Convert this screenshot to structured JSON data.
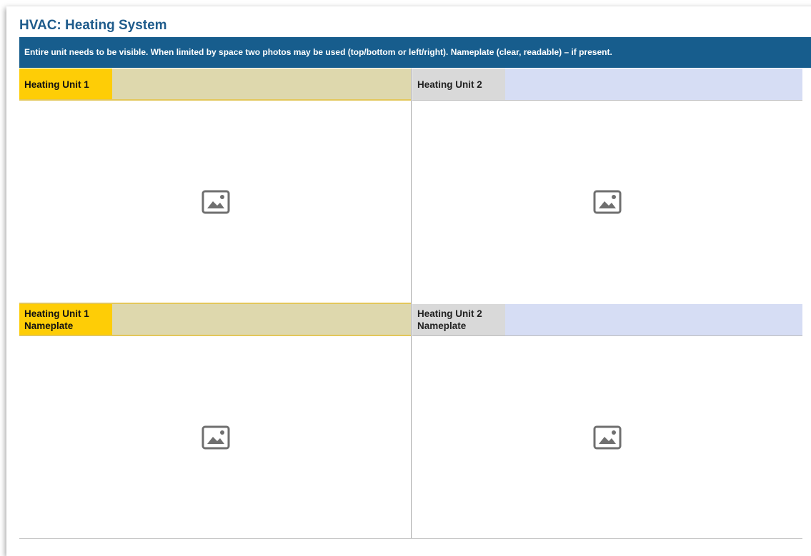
{
  "page": {
    "title": "HVAC: Heating System",
    "instructions": "Entire unit needs to be visible. When limited by space two photos may be used (top/bottom or left/right). Nameplate (clear, readable) – if present."
  },
  "rows": [
    {
      "left": {
        "label_line1": "Heating Unit 1",
        "label_line2": "",
        "photo_icon": "image-placeholder-icon"
      },
      "right": {
        "label_line1": "Heating Unit 2",
        "label_line2": "",
        "photo_icon": "image-placeholder-icon"
      }
    },
    {
      "left": {
        "label_line1": "Heating Unit 1",
        "label_line2": "Nameplate",
        "photo_icon": "image-placeholder-icon"
      },
      "right": {
        "label_line1": "Heating Unit 2",
        "label_line2": "Nameplate",
        "photo_icon": "image-placeholder-icon"
      }
    }
  ],
  "colors": {
    "title": "#1f5c8c",
    "banner_bg": "#175d8d",
    "unit1_label_bg": "#fecd06",
    "unit1_fill_bg": "#ded8ad",
    "unit2_label_bg": "#d9d9d9",
    "unit2_fill_bg": "#d6ddf4"
  }
}
